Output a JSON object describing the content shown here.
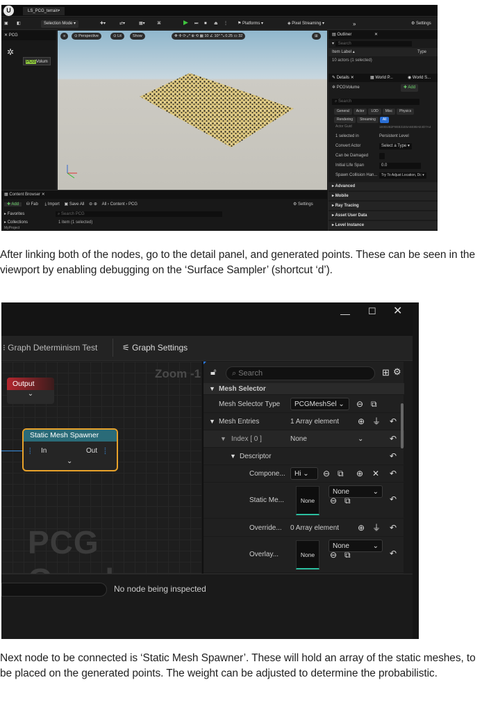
{
  "shot1": {
    "tab_title": "LS_PCG_terrain•",
    "selection_mode": "Selection Mode",
    "platforms": "Platforms",
    "pixel_streaming": "Pixel Streaming",
    "settings": "Settings",
    "left_search": "PCG",
    "left_item": "Volum",
    "left_item_badge": "PCG",
    "viewport": {
      "perspective": "Perspective",
      "lit": "Lit",
      "show": "Show",
      "grid": "10",
      "angle": "10°",
      "scale": "0.25",
      "cam": "32"
    },
    "outliner": {
      "title": "Outliner",
      "search_placeholder": "Search",
      "col_label": "Item Label",
      "col_type": "Type",
      "count": "10 actors (1 selected)"
    },
    "details": {
      "tab": "Details",
      "world_p": "World P...",
      "world_s": "World S...",
      "object": "PCGVolume",
      "add": "Add",
      "search_placeholder": "Search",
      "tabs_row1": [
        "General",
        "Actor",
        "LOD",
        "Misc",
        "Physics"
      ],
      "tabs_row2": [
        "Rendering",
        "Streaming",
        "All"
      ],
      "props": [
        {
          "label": "Actor Guid",
          "value": "1E0D2B2F8EB31E6A6E88AE4D7A4"
        },
        {
          "label": "1 selected in",
          "value": "Persistent Level"
        },
        {
          "label": "Convert Actor",
          "value": "Select a Type"
        },
        {
          "label": "Can be Damaged",
          "value": ""
        },
        {
          "label": "Initial Life Span",
          "value": "0.0"
        },
        {
          "label": "Spawn Collision Han...",
          "value": "Try To Adjust Location, Dc"
        }
      ],
      "categories": [
        "Advanced",
        "Mobile",
        "Ray Tracing",
        "Asset User Data",
        "Level Instance"
      ]
    },
    "content_browser": {
      "title": "Content Browser",
      "add": "Add",
      "fab": "Fab",
      "import": "Import",
      "save_all": "Save All",
      "path": [
        "All",
        "Content",
        "PCG"
      ],
      "settings": "Settings",
      "favorites": "Favorites",
      "collections": "Collections",
      "project": "MyProject",
      "search_placeholder": "Search PCG",
      "selected": "1 item (1 selected)"
    }
  },
  "caption1": "After linking both of the nodes, go to the detail panel, and generated points. These can be seen in the viewport by enabling debugging on the ‘Surface Sampler’ (shortcut ‘d’).",
  "shot2": {
    "tab_determinism": "Graph Determinism Test",
    "tab_settings": "Graph Settings",
    "zoom": "Zoom -1",
    "output_node": "Output",
    "spawner_node": "Static Mesh Spawner",
    "pin_in": "In",
    "pin_out": "Out",
    "watermark": "PCG Graph",
    "search_placeholder": "Search",
    "section": "Mesh Selector",
    "rows": [
      {
        "label": "Mesh Selector Type",
        "value": "PCGMeshSel"
      },
      {
        "label": "Mesh Entries",
        "value": "1 Array element"
      },
      {
        "label": "Index [ 0 ]",
        "value": "None"
      },
      {
        "label": "Descriptor",
        "value": ""
      },
      {
        "label": "Compone...",
        "value": "Hi"
      },
      {
        "label": "Static Me...",
        "value": "None"
      },
      {
        "label": "Override...",
        "value": "0 Array element"
      },
      {
        "label": "Overlay...",
        "value": "None"
      }
    ],
    "thumb_label": "None",
    "status": "No node being inspected"
  },
  "caption2": "Next node to be connected is ‘Static Mesh Spawner’. These will hold an array of the static meshes, to be placed on the generated points. The weight can  be adjusted to determine the probabilistic."
}
